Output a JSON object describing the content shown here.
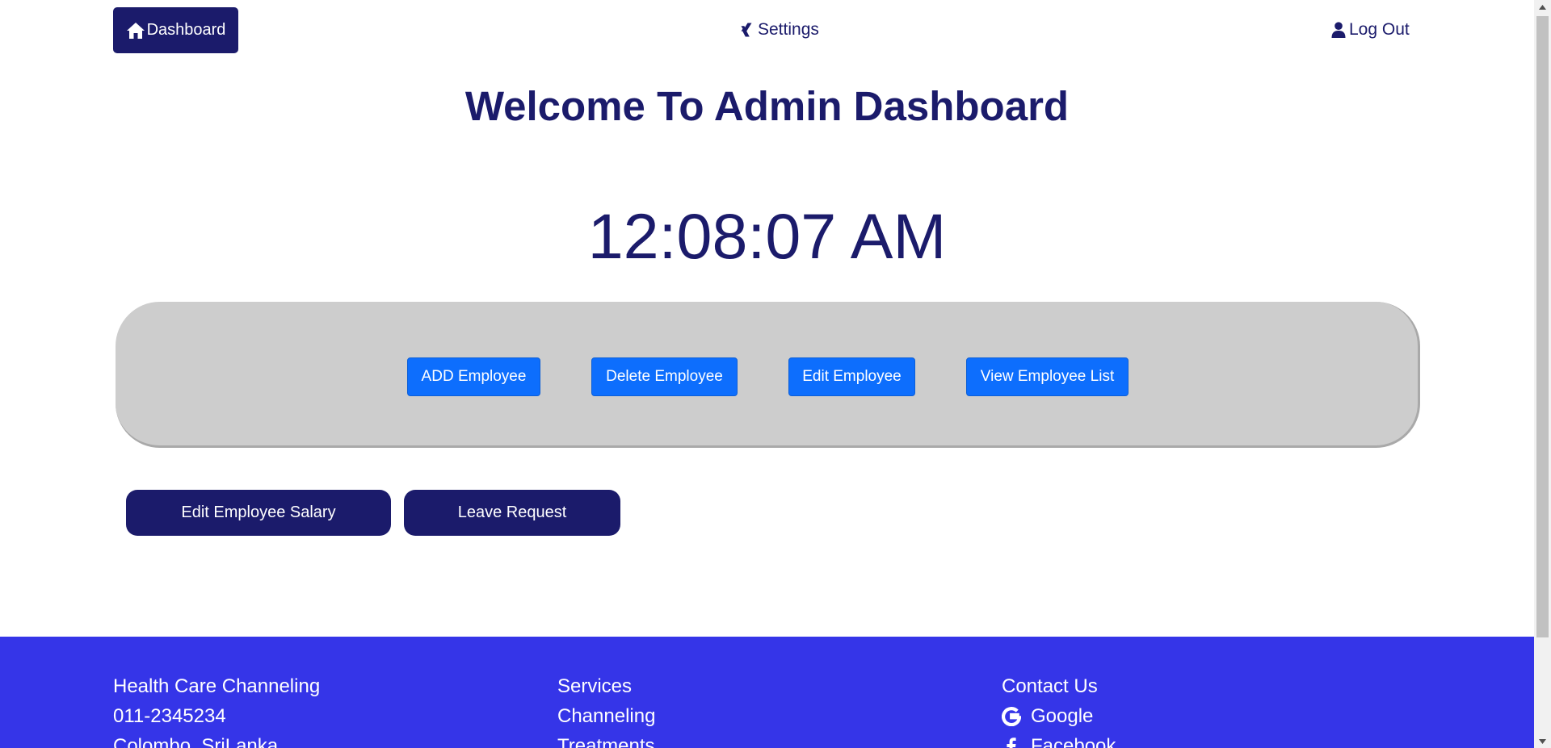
{
  "nav": {
    "dashboard_label": "Dashboard",
    "settings_label": "Settings",
    "logout_label": "Log Out",
    "icons": [
      "home-icon",
      "xing-icon",
      "user-icon"
    ]
  },
  "main": {
    "title": "Welcome To Admin Dashboard",
    "clock": "12:08:07 AM"
  },
  "employee_panel": {
    "add_label": "ADD Employee",
    "delete_label": "Delete Employee",
    "edit_label": "Edit Employee",
    "view_label": "View Employee List"
  },
  "actions": {
    "salary_label": "Edit Employee Salary",
    "leave_label": "Leave Request"
  },
  "footer": {
    "col1": [
      "Health Care Channeling",
      "011-2345234",
      "Colombo, SriLanka"
    ],
    "col2": [
      "Services",
      "Channeling",
      "Treatments"
    ],
    "col3": {
      "title": "Contact Us",
      "google": "Google",
      "facebook": "Facebook"
    }
  },
  "colors": {
    "navy": "#1b1b6b",
    "primary_blue": "#0d6efd",
    "footer_blue": "#3535e8",
    "panel_gray": "#cdcdcd"
  }
}
